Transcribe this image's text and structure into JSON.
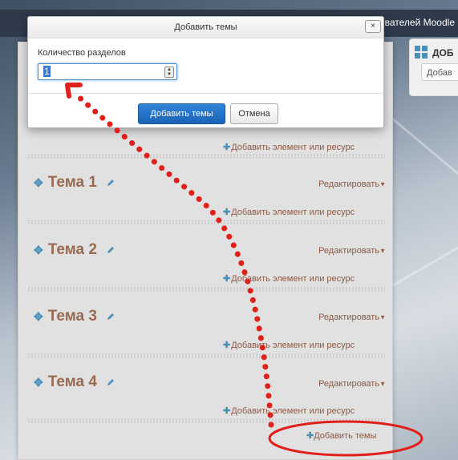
{
  "header": {
    "topbar_text": "вателей Moodle"
  },
  "side_block": {
    "title": "ДОБ",
    "button_label": "Добав"
  },
  "dialog": {
    "title": "Добавить темы",
    "close_icon": "×",
    "field_label": "Количество разделов",
    "field_value": "1",
    "submit_label": "Добавить темы",
    "cancel_label": "Отмена"
  },
  "course": {
    "add_resource_label": "Добавить элемент или ресурс",
    "edit_label": "Редактировать",
    "topics": [
      {
        "name": "Тема 1"
      },
      {
        "name": "Тема 2"
      },
      {
        "name": "Тема 3"
      },
      {
        "name": "Тема 4"
      }
    ],
    "add_topics_label": "Добавить темы"
  },
  "annotation": {
    "color": "#e0201b"
  },
  "colors": {
    "accent": "#1b63b7",
    "link": "#8a5a45",
    "icon": "#4a90b8",
    "topic": "#9a6a50"
  }
}
